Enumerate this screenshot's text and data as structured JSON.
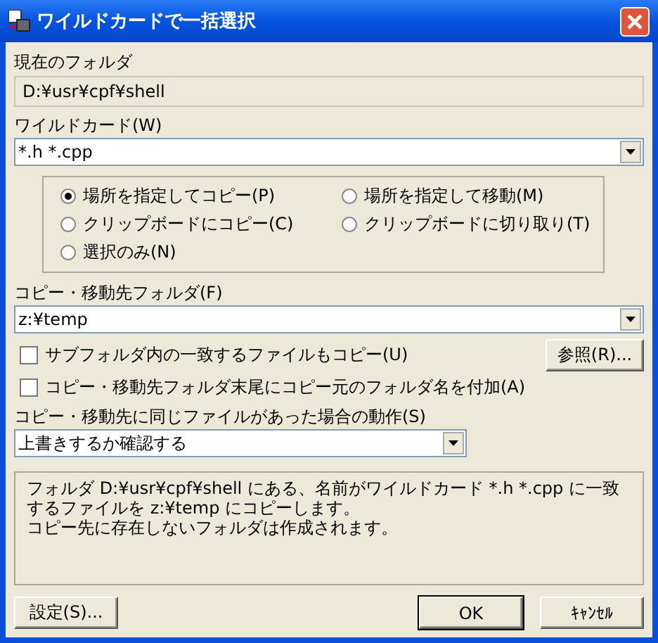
{
  "window": {
    "title": "ワイルドカードで一括選択"
  },
  "current_folder": {
    "label": "現在のフォルダ",
    "value": "D:¥usr¥cpf¥shell"
  },
  "wildcard": {
    "label": "ワイルドカード(W)",
    "value": "*.h *.cpp"
  },
  "modes": [
    {
      "label": "場所を指定してコピー(P)",
      "selected": true
    },
    {
      "label": "場所を指定して移動(M)",
      "selected": false
    },
    {
      "label": "クリップボードにコピー(C)",
      "selected": false
    },
    {
      "label": "クリップボードに切り取り(T)",
      "selected": false
    },
    {
      "label": "選択のみ(N)",
      "selected": false
    }
  ],
  "destination": {
    "label": "コピー・移動先フォルダ(F)",
    "value": "z:¥temp"
  },
  "options": [
    {
      "label": "サブフォルダ内の一致するファイルもコピー(U)",
      "checked": false
    },
    {
      "label": "コピー・移動先フォルダ末尾にコピー元のフォルダ名を付加(A)",
      "checked": false
    }
  ],
  "browse_button": "参照(R)...",
  "conflict": {
    "label": "コピー・移動先に同じファイルがあった場合の動作(S)",
    "value": "上書きするか確認する"
  },
  "description": [
    "フォルダ D:¥usr¥cpf¥shell にある、名前がワイルドカード *.h *.cpp に一致するファイルを z:¥temp にコピーします。",
    "コピー先に存在しないフォルダは作成されます。"
  ],
  "buttons": {
    "settings": "設定(S)...",
    "ok": "OK",
    "cancel": "ｷｬﾝｾﾙ"
  }
}
